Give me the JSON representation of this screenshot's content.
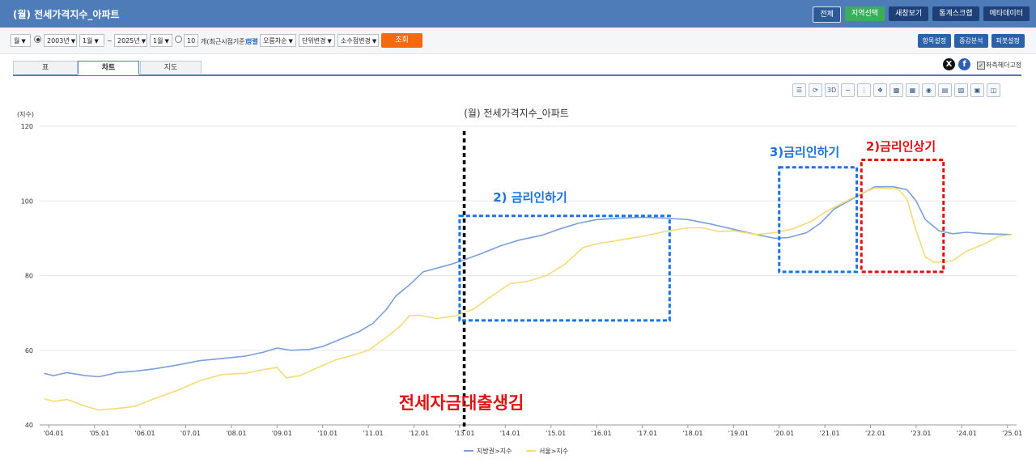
{
  "header": {
    "title": "(월) 전세가격지수_아파트",
    "buttons": [
      "전체",
      "지역선택",
      "새창보기",
      "통계스크랩",
      "메타데이터"
    ]
  },
  "toolbar": {
    "period": "월",
    "start_year": "2003년",
    "start_month": "1월",
    "tilde": "~",
    "end_year": "2025년",
    "end_month": "1월",
    "recent_count": "10",
    "recent_label": "개(최근시점기준)",
    "sort_label": "정렬",
    "sort_value": "오름차순",
    "unit_change": "단위변경",
    "decimal_change": "소수점변경",
    "query_button": "조회",
    "right_buttons": [
      "항목설정",
      "증감분석",
      "피봇설정"
    ]
  },
  "tabs": [
    "표",
    "차트",
    "지도"
  ],
  "social": {
    "x": "X",
    "facebook": "f",
    "fixed_header_label": "좌측헤더고정"
  },
  "chart_icons": [
    "list-icon",
    "refresh-icon",
    "3d-icon",
    "line-chart-icon",
    "scatter-icon",
    "mixed-chart-icon",
    "bar-chart-icon",
    "stacked-bar-icon",
    "bubble-icon",
    "horizontal-bar-icon",
    "column-icon",
    "combo-icon",
    "save-icon"
  ],
  "chart_icon_labels": {
    "3d": "3D"
  },
  "chart_data": {
    "type": "line",
    "title": "(월) 전세가격지수_아파트",
    "ylabel": "(지수)",
    "ylim": [
      40,
      120
    ],
    "yticks": [
      40,
      60,
      80,
      100,
      120
    ],
    "xlim": [
      2003.8,
      2025.2
    ],
    "xticks": [
      {
        "x": 2004,
        "label": "'04.01"
      },
      {
        "x": 2005,
        "label": "'05.01"
      },
      {
        "x": 2006,
        "label": "'06.01"
      },
      {
        "x": 2007,
        "label": "'07.01"
      },
      {
        "x": 2008,
        "label": "'08.01"
      },
      {
        "x": 2009,
        "label": "'09.01"
      },
      {
        "x": 2010,
        "label": "'10.01"
      },
      {
        "x": 2011,
        "label": "'11.01"
      },
      {
        "x": 2012,
        "label": "'12.01"
      },
      {
        "x": 2013,
        "label": "'13.01"
      },
      {
        "x": 2014,
        "label": "'14.01"
      },
      {
        "x": 2015,
        "label": "'15.01"
      },
      {
        "x": 2016,
        "label": "'16.01"
      },
      {
        "x": 2017,
        "label": "'17.01"
      },
      {
        "x": 2018,
        "label": "'18.01"
      },
      {
        "x": 2019,
        "label": "'19.01"
      },
      {
        "x": 2020,
        "label": "'20.01"
      },
      {
        "x": 2021,
        "label": "'21.01"
      },
      {
        "x": 2022,
        "label": "'22.01"
      },
      {
        "x": 2023,
        "label": "'23.01"
      },
      {
        "x": 2024,
        "label": "'24.01"
      },
      {
        "x": 2025,
        "label": "'25.01"
      }
    ],
    "grid": true,
    "legend": "bottom",
    "series": [
      {
        "name": "지방권>지수",
        "color": "#7a9fd9",
        "points": [
          [
            2003.9,
            53.8
          ],
          [
            2004.1,
            53.2
          ],
          [
            2004.4,
            54.0
          ],
          [
            2004.8,
            53.2
          ],
          [
            2005.1,
            52.9
          ],
          [
            2005.5,
            54.0
          ],
          [
            2005.9,
            54.4
          ],
          [
            2006.3,
            55.0
          ],
          [
            2006.8,
            56.0
          ],
          [
            2007.3,
            57.2
          ],
          [
            2007.8,
            57.8
          ],
          [
            2008.3,
            58.4
          ],
          [
            2008.7,
            59.5
          ],
          [
            2009.0,
            60.6
          ],
          [
            2009.3,
            60.0
          ],
          [
            2009.7,
            60.2
          ],
          [
            2010.0,
            61.0
          ],
          [
            2010.4,
            63.0
          ],
          [
            2010.8,
            65.0
          ],
          [
            2011.1,
            67.2
          ],
          [
            2011.4,
            71.0
          ],
          [
            2011.6,
            74.5
          ],
          [
            2011.9,
            77.5
          ],
          [
            2012.2,
            81.0
          ],
          [
            2012.5,
            82.0
          ],
          [
            2012.8,
            83.0
          ],
          [
            2013.1,
            84.2
          ],
          [
            2013.5,
            86.0
          ],
          [
            2013.9,
            88.0
          ],
          [
            2014.3,
            89.5
          ],
          [
            2014.8,
            90.8
          ],
          [
            2015.2,
            92.5
          ],
          [
            2015.6,
            94.0
          ],
          [
            2016.0,
            95.0
          ],
          [
            2016.5,
            95.4
          ],
          [
            2017.0,
            95.6
          ],
          [
            2017.5,
            95.4
          ],
          [
            2018.0,
            95.0
          ],
          [
            2018.5,
            93.8
          ],
          [
            2019.0,
            92.4
          ],
          [
            2019.5,
            91.0
          ],
          [
            2019.9,
            90.0
          ],
          [
            2020.2,
            90.2
          ],
          [
            2020.6,
            91.5
          ],
          [
            2020.9,
            94.0
          ],
          [
            2021.2,
            97.8
          ],
          [
            2021.6,
            100.5
          ],
          [
            2021.9,
            102.5
          ],
          [
            2022.1,
            103.8
          ],
          [
            2022.5,
            103.8
          ],
          [
            2022.8,
            103.0
          ],
          [
            2023.0,
            100.0
          ],
          [
            2023.2,
            95.0
          ],
          [
            2023.5,
            92.0
          ],
          [
            2023.8,
            91.2
          ],
          [
            2024.1,
            91.6
          ],
          [
            2024.5,
            91.2
          ],
          [
            2025.1,
            91.0
          ]
        ]
      },
      {
        "name": "서울>지수",
        "color": "#f5da7a",
        "points": [
          [
            2003.9,
            47.0
          ],
          [
            2004.1,
            46.3
          ],
          [
            2004.4,
            46.8
          ],
          [
            2004.8,
            45.0
          ],
          [
            2005.1,
            44.0
          ],
          [
            2005.5,
            44.4
          ],
          [
            2005.9,
            45.0
          ],
          [
            2006.3,
            47.0
          ],
          [
            2006.8,
            49.2
          ],
          [
            2007.3,
            51.8
          ],
          [
            2007.8,
            53.5
          ],
          [
            2008.3,
            53.8
          ],
          [
            2008.7,
            54.8
          ],
          [
            2009.0,
            55.4
          ],
          [
            2009.2,
            52.6
          ],
          [
            2009.5,
            53.2
          ],
          [
            2009.9,
            55.4
          ],
          [
            2010.3,
            57.5
          ],
          [
            2010.7,
            58.8
          ],
          [
            2011.0,
            60.0
          ],
          [
            2011.4,
            63.5
          ],
          [
            2011.7,
            66.5
          ],
          [
            2011.9,
            69.2
          ],
          [
            2012.1,
            69.4
          ],
          [
            2012.5,
            68.5
          ],
          [
            2012.9,
            69.2
          ],
          [
            2013.3,
            71.0
          ],
          [
            2013.7,
            74.5
          ],
          [
            2014.1,
            77.8
          ],
          [
            2014.5,
            78.5
          ],
          [
            2014.9,
            80.0
          ],
          [
            2015.3,
            83.0
          ],
          [
            2015.7,
            87.5
          ],
          [
            2016.0,
            88.5
          ],
          [
            2016.5,
            89.5
          ],
          [
            2017.0,
            90.5
          ],
          [
            2017.5,
            91.8
          ],
          [
            2018.0,
            92.8
          ],
          [
            2018.3,
            92.8
          ],
          [
            2018.7,
            91.8
          ],
          [
            2019.0,
            92.0
          ],
          [
            2019.5,
            91.0
          ],
          [
            2019.9,
            91.5
          ],
          [
            2020.3,
            92.5
          ],
          [
            2020.7,
            94.5
          ],
          [
            2021.0,
            97.0
          ],
          [
            2021.4,
            99.5
          ],
          [
            2021.8,
            102.0
          ],
          [
            2022.1,
            103.5
          ],
          [
            2022.6,
            103.2
          ],
          [
            2022.8,
            100.5
          ],
          [
            2023.0,
            92.0
          ],
          [
            2023.2,
            85.0
          ],
          [
            2023.4,
            83.5
          ],
          [
            2023.8,
            84.0
          ],
          [
            2024.1,
            86.5
          ],
          [
            2024.5,
            88.5
          ],
          [
            2024.8,
            90.5
          ],
          [
            2025.1,
            91.0
          ]
        ]
      }
    ],
    "annotations": {
      "black_line_x": 2013.1,
      "black_line_text": "전세자금대출생김",
      "box1": {
        "x0": 2013.0,
        "x1": 2017.6,
        "y0": 68,
        "y1": 96,
        "text": "2) 금리인하기"
      },
      "box2": {
        "x0": 2020.0,
        "x1": 2021.7,
        "y0": 81,
        "y1": 109,
        "text": "3)금리인하기"
      },
      "box3": {
        "x0": 2021.8,
        "x1": 2023.6,
        "y0": 81,
        "y1": 111,
        "text": "2)금리인상기"
      }
    }
  }
}
